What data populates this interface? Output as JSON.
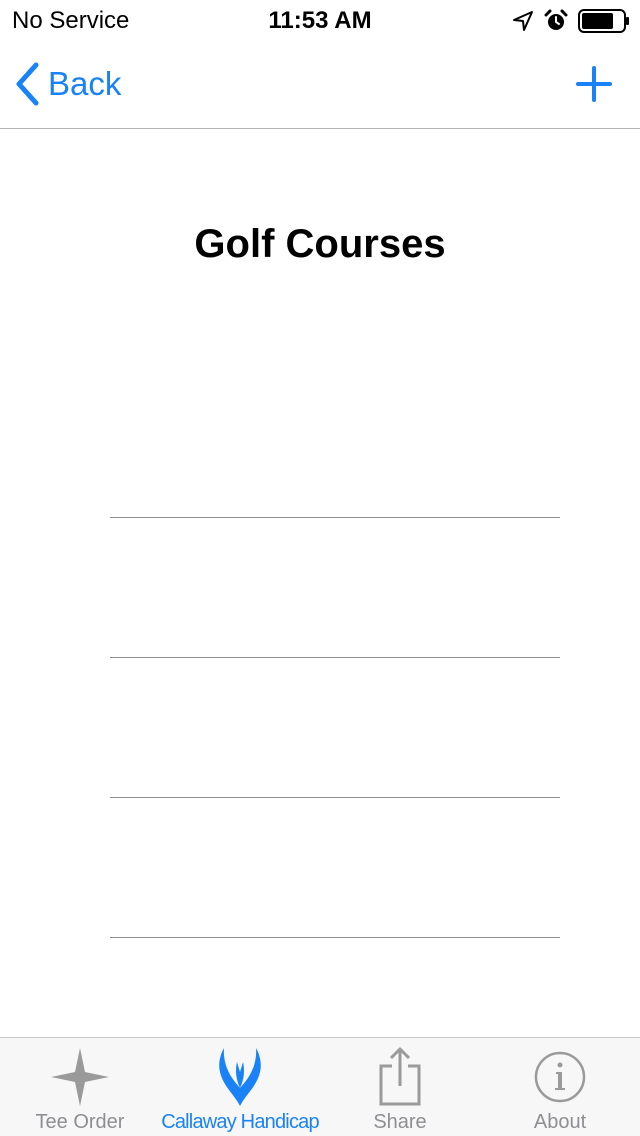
{
  "status_bar": {
    "carrier": "No Service",
    "time": "11:53 AM",
    "icons": [
      "location-arrow-icon",
      "alarm-clock-icon",
      "battery-icon"
    ]
  },
  "nav": {
    "back_label": "Back",
    "add_icon": "plus-icon"
  },
  "page": {
    "title": "Golf Courses",
    "list_rows": 4
  },
  "tab_bar": {
    "tabs": [
      {
        "label": "Tee Order",
        "icon": "four-point-star-icon",
        "active": false
      },
      {
        "label": "Callaway Handicap",
        "icon": "callaway-logo-icon",
        "active": true
      },
      {
        "label": "Share",
        "icon": "share-icon",
        "active": false
      },
      {
        "label": "About",
        "icon": "info-icon",
        "active": false
      }
    ]
  },
  "colors": {
    "accent": "#1a82f7",
    "inactive": "#8e8e93",
    "divider": "#8e8e8e"
  }
}
